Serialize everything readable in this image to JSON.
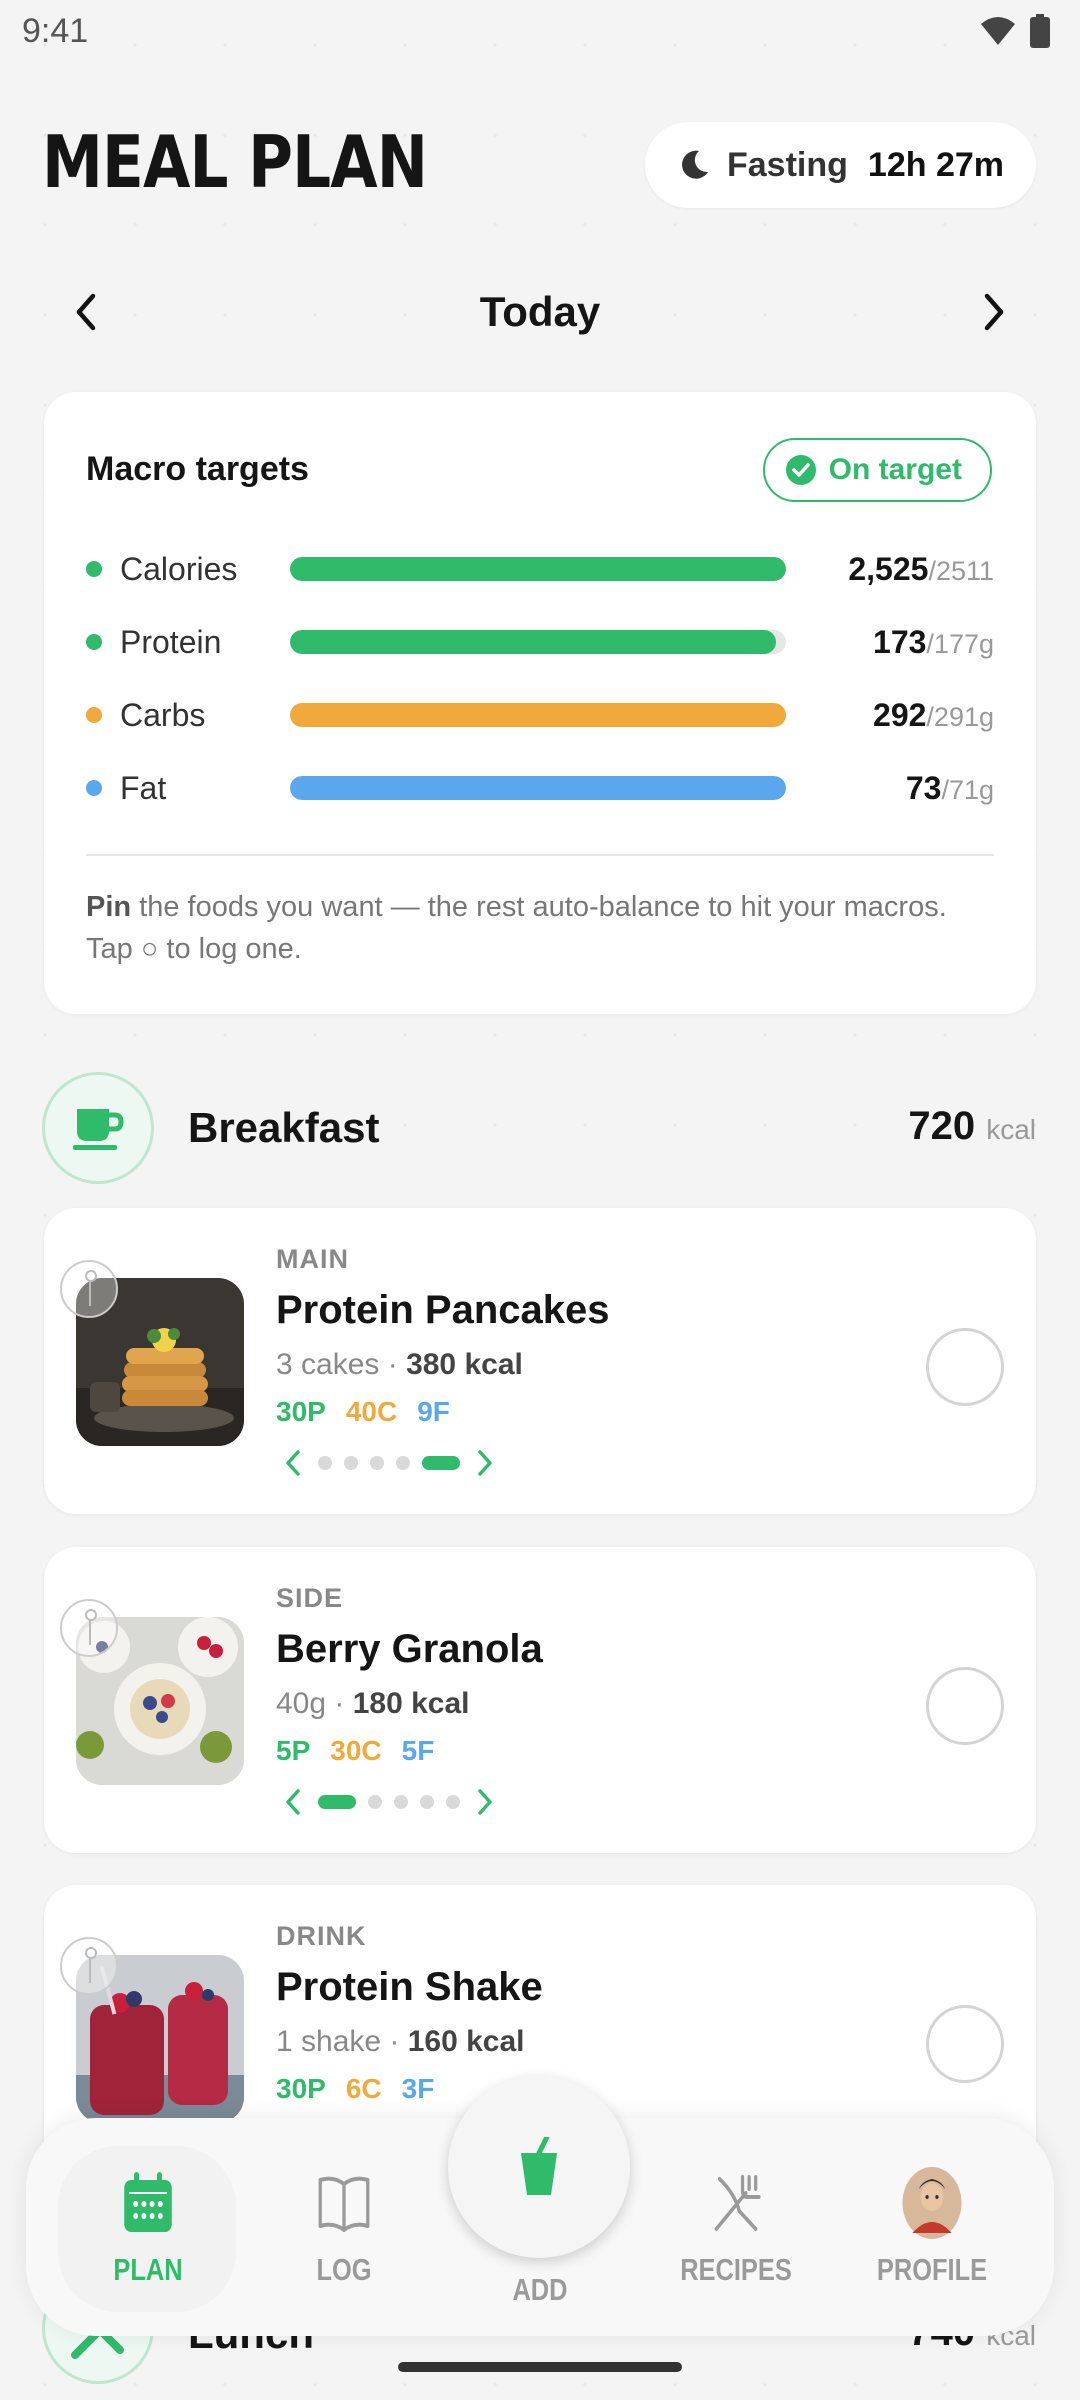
{
  "status": {
    "time": "9:41"
  },
  "header": {
    "title": "MEAL PLAN",
    "fasting_label": "Fasting",
    "fasting_value": "12h 27m"
  },
  "date_nav": {
    "label": "Today"
  },
  "macro_card": {
    "title": "Macro targets",
    "badge": "On target",
    "rows": [
      {
        "name": "Calories",
        "value": "2,525",
        "target": "/2511",
        "fill": 1.0,
        "color": "#2fbb6a"
      },
      {
        "name": "Protein",
        "value": "173",
        "target": "/177g",
        "fill": 0.98,
        "color": "#2fbb6a"
      },
      {
        "name": "Carbs",
        "value": "292",
        "target": "/291g",
        "fill": 1.0,
        "color": "#f0a93a"
      },
      {
        "name": "Fat",
        "value": "73",
        "target": "/71g",
        "fill": 1.0,
        "color": "#5aa7ee"
      }
    ],
    "hint_bold": "Pin",
    "hint_text": " the foods you want — the rest auto-balance to hit your macros. Tap ○ to log one."
  },
  "meals": [
    {
      "title": "Breakfast",
      "kcal": "720",
      "kcal_unit": "kcal",
      "items": [
        {
          "category": "MAIN",
          "name": "Protein Pancakes",
          "portion": "3 cakes · ",
          "kcal": "380 kcal",
          "p": "30P",
          "c": "40C",
          "f": "9F",
          "pager_active": 4,
          "pager_count": 5
        },
        {
          "category": "SIDE",
          "name": "Berry Granola",
          "portion": "40g · ",
          "kcal": "180 kcal",
          "p": "5P",
          "c": "30C",
          "f": "5F",
          "pager_active": 0,
          "pager_count": 5
        },
        {
          "category": "DRINK",
          "name": "Protein Shake",
          "portion": "1 shake · ",
          "kcal": "160 kcal",
          "p": "30P",
          "c": "6C",
          "f": "3F"
        }
      ]
    },
    {
      "title": "Lunch",
      "kcal": "740",
      "kcal_unit": "kcal"
    }
  ],
  "bottom_nav": {
    "plan": "PLAN",
    "log": "LOG",
    "add": "ADD",
    "recipes": "RECIPES",
    "profile": "PROFILE"
  },
  "colors": {
    "accent": "#2fbb6a",
    "carbs": "#f0a93a",
    "fat": "#5aa7ee"
  }
}
